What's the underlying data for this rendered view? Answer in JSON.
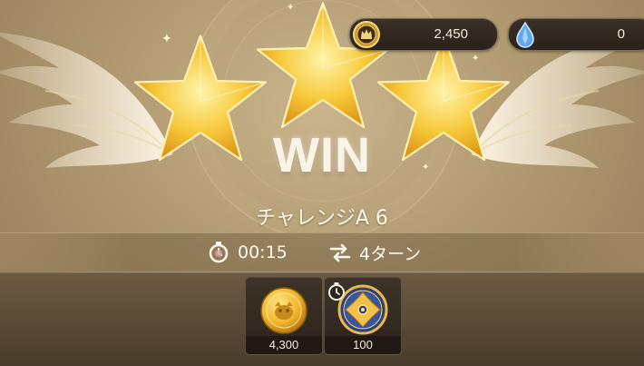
{
  "currency": {
    "gold": {
      "icon": "crown-coin-icon",
      "value": "2,450"
    },
    "gems": {
      "icon": "crystal-gem-icon",
      "value": "0"
    }
  },
  "result": {
    "stars_earned": 3,
    "stars_total": 3,
    "title": "WIN",
    "stage_name": "チャレンジA 6"
  },
  "stats": {
    "time": {
      "icon": "stopwatch-icon",
      "value": "00:15"
    },
    "turns": {
      "icon": "swap-arrows-icon",
      "value": "4ターン"
    }
  },
  "rewards": [
    {
      "icon": "gold-coin-icon",
      "quantity": "4,300"
    },
    {
      "icon": "medal-emblem-icon",
      "quantity": "100",
      "badge": "timer-icon"
    }
  ],
  "colors": {
    "gold": "#f5c542",
    "background": "#b19a72",
    "text": "#fffaf0"
  }
}
